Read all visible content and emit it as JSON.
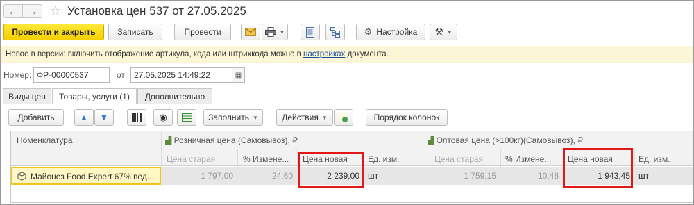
{
  "window": {
    "title": "Установка цен 537 от 27.05.2025",
    "back_icon": "←",
    "forward_icon": "→",
    "favorite_icon": "☆"
  },
  "toolbar": {
    "post_and_close": "Провести и закрыть",
    "save": "Записать",
    "post": "Провести",
    "settings": "Настройка"
  },
  "info": {
    "text_before": "Новое в версии: включить отображение артикула, кода или штрихкода можно в ",
    "link": "настройках",
    "text_after": " документа."
  },
  "header_fields": {
    "number_label": "Номер:",
    "number_value": "ФР-00000537",
    "date_label": "от:",
    "date_value": "27.05.2025 14:49:22"
  },
  "tabs": [
    {
      "label": "Виды цен",
      "active": false
    },
    {
      "label": "Товары, услуги (1)",
      "active": true
    },
    {
      "label": "Дополнительно",
      "active": false
    }
  ],
  "table_toolbar": {
    "add": "Добавить",
    "fill": "Заполнить",
    "actions": "Действия",
    "column_order": "Порядок колонок"
  },
  "table": {
    "col_nomenclature": "Номенклатура",
    "group_retail": "Розничная цена (Самовывоз), ₽",
    "group_wholesale": "Оптовая цена (>100кг)(Самовывоз), ₽",
    "sub_old_price": "Цена старая",
    "sub_change": "% Измене...",
    "sub_new_price": "Цена новая",
    "sub_unit": "Ед. изм.",
    "rows": [
      {
        "name": "Майонез Food Expert 67% вед...",
        "retail_old": "1 797,00",
        "retail_change": "24,60",
        "retail_new": "2 239,00",
        "retail_unit": "шт",
        "wholesale_old": "1 759,15",
        "wholesale_change": "10,48",
        "wholesale_new": "1 943,45",
        "wholesale_unit": "шт"
      }
    ]
  },
  "colors": {
    "primary_button": "#f5cf00",
    "info_bar": "#fbf6d6",
    "highlight_border": "#e01818",
    "selected_cell": "#fff7c4"
  }
}
